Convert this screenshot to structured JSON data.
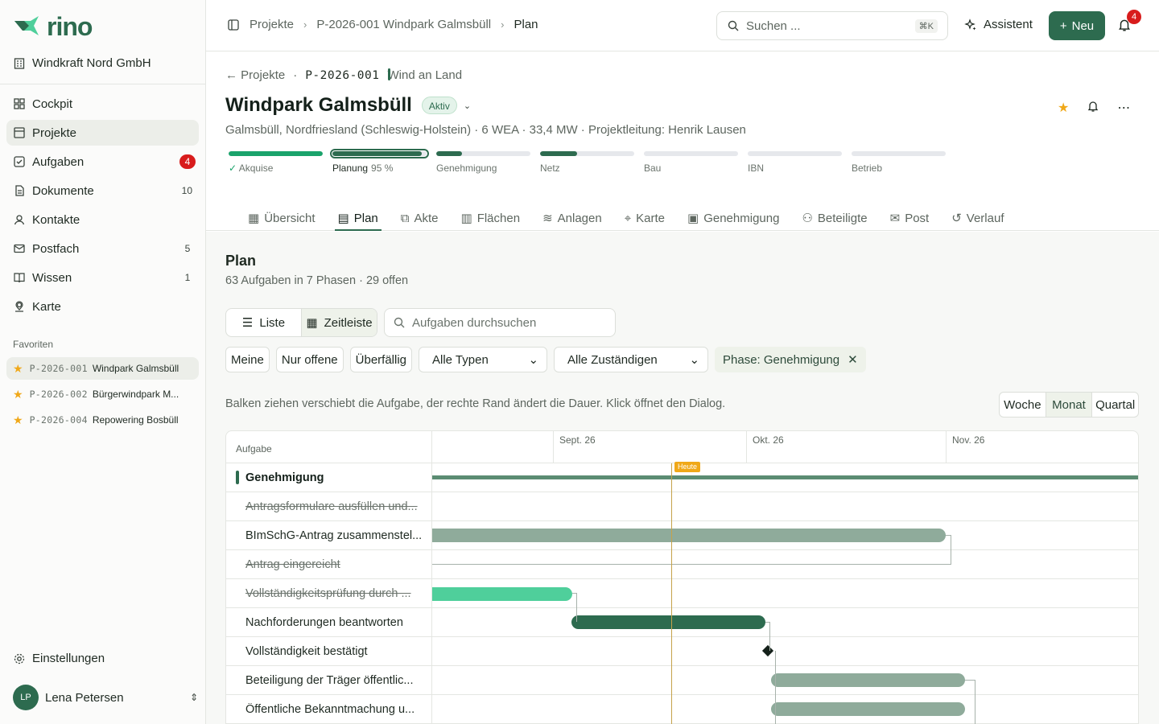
{
  "brand": {
    "name": "rino",
    "accent": "#2d6b4f"
  },
  "org": "Windkraft Nord GmbH",
  "nav": [
    {
      "label": "Cockpit",
      "icon": "grid-icon"
    },
    {
      "label": "Projekte",
      "icon": "folder-icon",
      "active": true
    },
    {
      "label": "Aufgaben",
      "icon": "checkbox-icon",
      "count": "4"
    },
    {
      "label": "Dokumente",
      "icon": "document-icon",
      "count": "10"
    },
    {
      "label": "Kontakte",
      "icon": "contacts-icon"
    },
    {
      "label": "Postfach",
      "icon": "mail-icon",
      "count": "5"
    },
    {
      "label": "Wissen",
      "icon": "book-icon",
      "count": "1"
    },
    {
      "label": "Karte",
      "icon": "map-pin-icon"
    }
  ],
  "favorites": {
    "title": "Favoriten",
    "items": [
      {
        "code": "P-2026-001",
        "name": "Windpark Galmsbüll"
      },
      {
        "code": "P-2026-002",
        "name": "Bürgerwindpark M..."
      },
      {
        "code": "P-2026-004",
        "name": "Repowering Bosbüll"
      }
    ]
  },
  "settings_label": "Einstellungen",
  "user": {
    "initials": "LP",
    "name": "Lena Petersen"
  },
  "topbar": {
    "crumbs": [
      "Projekte",
      "P-2026-001 Windpark Galmsbüll",
      "Plan"
    ],
    "search_placeholder": "Suchen ...",
    "search_kbd": "⌘K",
    "assistant_label": "Assistent",
    "new_label": "Neu",
    "notif_count": "4"
  },
  "project": {
    "back_label": "Projekte",
    "code": "P-2026-001",
    "type": "Wind an Land",
    "title": "Windpark Galmsbüll",
    "status": "Aktiv",
    "meta": "Galmsbüll, Nordfriesland (Schleswig-Holstein) · 6 WEA · 33,4 MW · Projektleitung: Henrik Lausen",
    "phases": [
      {
        "label": "Akquise",
        "progress": 1.0,
        "state": "done"
      },
      {
        "label": "Planung",
        "pct": "95 %",
        "progress": 0.95,
        "state": "current"
      },
      {
        "label": "Genehmigung",
        "progress": 0.27,
        "state": "todo"
      },
      {
        "label": "Netz",
        "progress": 0.39,
        "state": "todo"
      },
      {
        "label": "Bau",
        "progress": 0,
        "state": "todo"
      },
      {
        "label": "IBN",
        "progress": 0,
        "state": "todo"
      },
      {
        "label": "Betrieb",
        "progress": 0,
        "state": "todo"
      }
    ]
  },
  "tabs": [
    {
      "label": "Übersicht",
      "icon": "grid-icon"
    },
    {
      "label": "Plan",
      "icon": "calendar-icon",
      "active": true
    },
    {
      "label": "Akte",
      "icon": "paperclip-icon"
    },
    {
      "label": "Flächen",
      "icon": "map-icon"
    },
    {
      "label": "Anlagen",
      "icon": "wind-icon"
    },
    {
      "label": "Karte",
      "icon": "map-pin-icon"
    },
    {
      "label": "Genehmigung",
      "icon": "stamp-icon"
    },
    {
      "label": "Beteiligte",
      "icon": "users-icon"
    },
    {
      "label": "Post",
      "icon": "mail-icon"
    },
    {
      "label": "Verlauf",
      "icon": "history-icon"
    }
  ],
  "plan": {
    "title": "Plan",
    "subtitle": "63 Aufgaben in 7 Phasen · 29 offen",
    "view_list": "Liste",
    "view_timeline": "Zeitleiste",
    "task_search_placeholder": "Aufgaben durchsuchen",
    "filter_mine": "Meine",
    "filter_open": "Nur offene",
    "filter_overdue": "Überfällig",
    "type_select": "Alle Typen",
    "assignee_select": "Alle Zuständigen",
    "phase_chip": "Phase: Genehmigung",
    "hint": "Balken ziehen verschiebt die Aufgabe, der rechte Rand ändert die Dauer. Klick öffnet den Dialog.",
    "scale": [
      "Woche",
      "Monat",
      "Quartal"
    ],
    "scale_active": "Monat"
  },
  "gantt": {
    "task_col": "Aufgabe",
    "months": [
      "Sept. 26",
      "Okt. 26",
      "Nov. 26"
    ],
    "today_label": "Heute",
    "group": "Genehmigung",
    "tasks": [
      {
        "name": "Antragsformulare ausfüllen und...",
        "done": true
      },
      {
        "name": "BImSchG-Antrag zusammenstel...",
        "done": false
      },
      {
        "name": "Antrag eingereicht",
        "done": true
      },
      {
        "name": "Vollständigkeitsprüfung durch ...",
        "done": true
      },
      {
        "name": "Nachforderungen beantworten",
        "done": false
      },
      {
        "name": "Vollständigkeit bestätigt",
        "done": false
      },
      {
        "name": "Beteiligung der Träger öffentlic...",
        "done": false
      },
      {
        "name": "Öffentliche Bekanntmachung u...",
        "done": false
      }
    ]
  }
}
